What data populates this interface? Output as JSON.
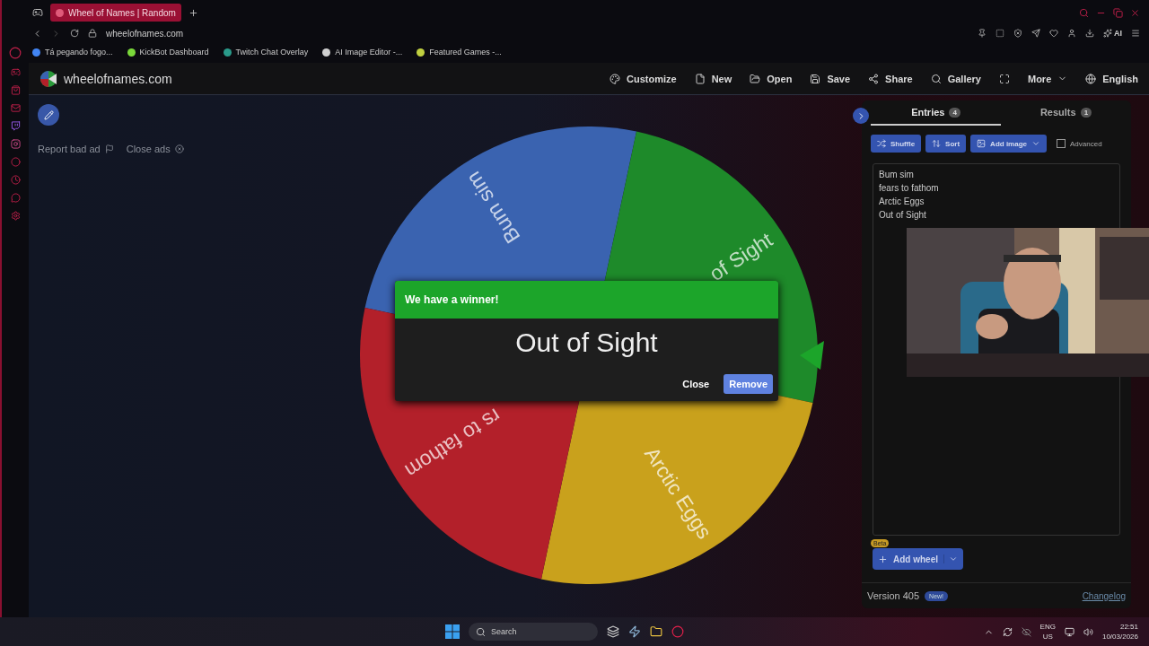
{
  "browser": {
    "tab_title": "Wheel of Names | Random",
    "url": "wheelofnames.com",
    "bookmarks": [
      "Tá pegando fogo...",
      "KickBot Dashboard",
      "Twitch Chat Overlay",
      "AI Image Editor -...",
      "Featured Games -..."
    ],
    "ai_label": "AI"
  },
  "header": {
    "site_name": "wheelofnames.com",
    "menu": [
      "Customize",
      "New",
      "Open",
      "Save",
      "Share",
      "Gallery"
    ],
    "more": "More",
    "language": "English"
  },
  "ads": [
    "Report bad ad",
    "Close ads"
  ],
  "wheel": {
    "segments": [
      {
        "label": "Bum sim",
        "color": "#3a63b0"
      },
      {
        "label": "of Sight",
        "color": "#1e8a2a"
      },
      {
        "label": "Arctic Eggs",
        "color": "#c9a11c"
      },
      {
        "label": "rs to fathom",
        "color": "#b3202a"
      }
    ]
  },
  "dialog": {
    "title": "We have a winner!",
    "winner": "Out of Sight",
    "buttons": [
      "Close",
      "Remove"
    ]
  },
  "panel": {
    "tabs": [
      {
        "label": "Entries",
        "count": "4",
        "selected": true
      },
      {
        "label": "Results",
        "count": "1",
        "selected": false
      }
    ],
    "tools": [
      "Shuffle",
      "Sort",
      "Add image"
    ],
    "advanced": {
      "label": "Advanced",
      "checked": false
    },
    "entries": [
      "Bum sim",
      "fears to fathom",
      "Arctic Eggs",
      "Out of Sight"
    ],
    "add_wheel": {
      "label": "Add wheel",
      "badge": "Beta"
    },
    "version": "Version 405",
    "new_badge": "New!",
    "changelog": "Changelog"
  },
  "webcam": {
    "kind": "picture"
  },
  "taskbar": {
    "search": "Search",
    "lang": [
      "ENG",
      "US"
    ],
    "time": "22:51",
    "date": "10/03/2026"
  }
}
